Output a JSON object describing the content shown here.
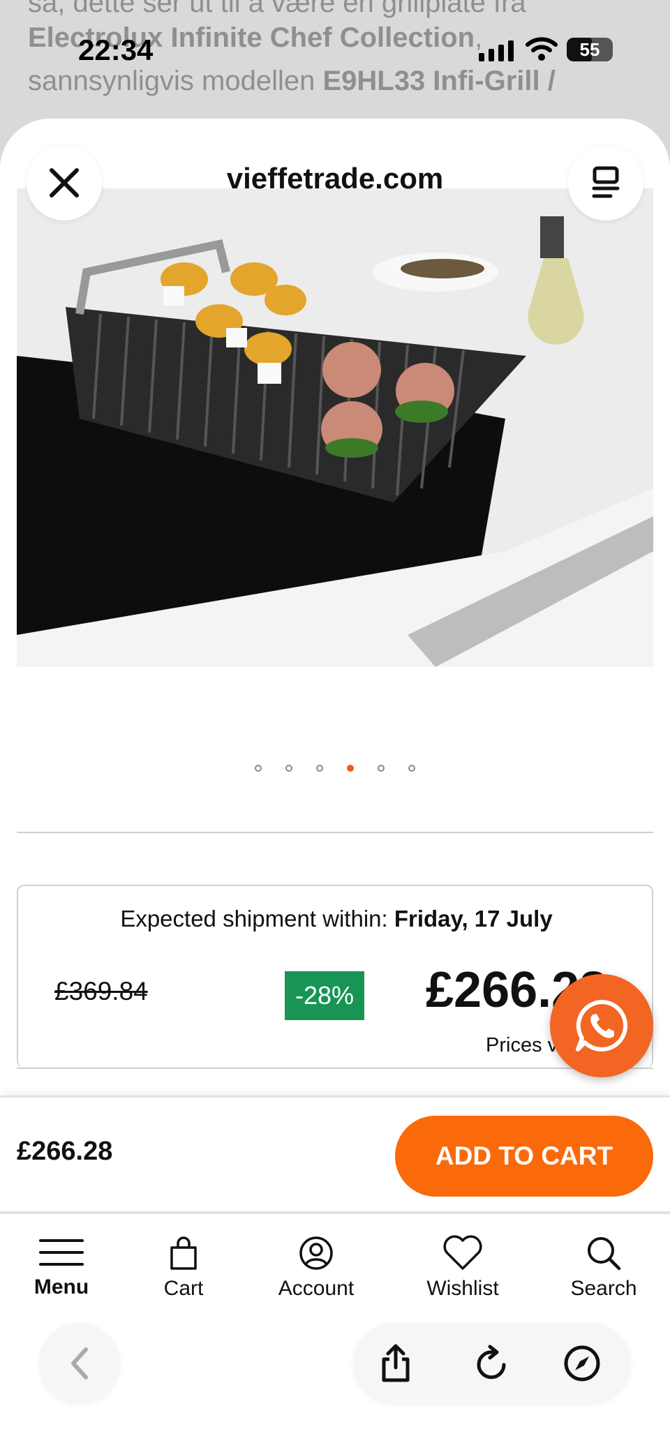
{
  "background_article": {
    "line1": "så, dette ser ut til å være en grillplate fra",
    "line2_bold": "Electrolux Infinite Chef Collection",
    "line2_rest": ",",
    "line3_start": "sannsynligvis modellen ",
    "line3_bold": "E9HL33 Infi-Grill /"
  },
  "status_bar": {
    "time": "22:34",
    "battery": "55"
  },
  "sheet": {
    "site_title": "vieffetrade.com"
  },
  "carousel": {
    "total": 6,
    "active_index": 3
  },
  "price_card": {
    "shipment_label": "Expected shipment within: ",
    "shipment_date": "Friday, 17 July",
    "old_price": "£369.84",
    "discount": "-28%",
    "new_price": "£266.28",
    "prices_note": "Prices vary"
  },
  "cart_bar": {
    "price": "£266.28",
    "add_to_cart": "ADD TO CART"
  },
  "bottom_nav": {
    "menu": "Menu",
    "cart": "Cart",
    "account": "Account",
    "wishlist": "Wishlist",
    "search": "Search"
  },
  "colors": {
    "accent": "#fa6a0a",
    "discount": "#189455",
    "whatsapp_button": "#f26522"
  },
  "icons": {
    "close": "close-icon",
    "reader": "reader-icon",
    "whatsapp": "whatsapp-icon",
    "menu": "hamburger-icon",
    "cart": "bag-icon",
    "account": "account-icon",
    "wishlist": "heart-icon",
    "search": "search-icon",
    "back": "chevron-left-icon",
    "share": "share-icon",
    "reload": "reload-icon",
    "compass": "compass-icon"
  }
}
